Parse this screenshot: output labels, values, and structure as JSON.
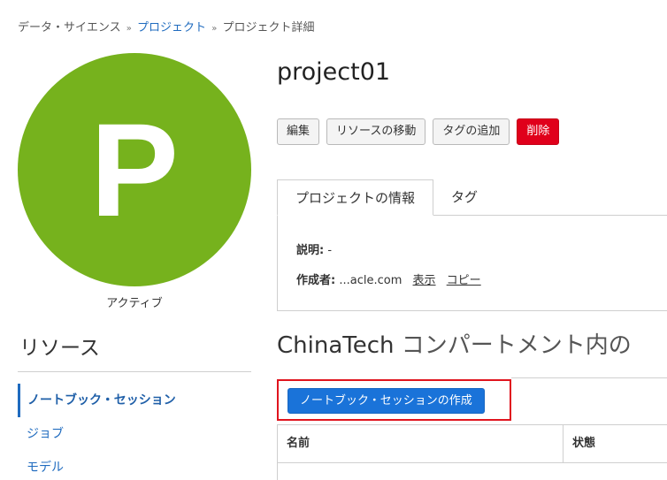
{
  "breadcrumb": {
    "root": "データ・サイエンス",
    "separator": "»",
    "projects": "プロジェクト",
    "current": "プロジェクト詳細"
  },
  "avatar": {
    "letter": "P",
    "color": "#76b21d"
  },
  "status": "アクティブ",
  "project": {
    "title": "project01"
  },
  "actions": {
    "edit": "編集",
    "move": "リソースの移動",
    "add_tag": "タグの追加",
    "delete": "削除"
  },
  "tabs": [
    {
      "label": "プロジェクトの情報",
      "active": true
    },
    {
      "label": "タグ",
      "active": false
    }
  ],
  "info": {
    "description_label": "説明:",
    "description_value": "-",
    "created_by_label": "作成者:",
    "created_by_value": "...acle.com",
    "show_link": "表示",
    "copy_link": "コピー"
  },
  "sidebar": {
    "heading": "リソース",
    "items": [
      {
        "label": "ノートブック・セッション",
        "active": true
      },
      {
        "label": "ジョブ",
        "active": false
      },
      {
        "label": "モデル",
        "active": false
      }
    ]
  },
  "section": {
    "heading_compartment": "ChinaTech",
    "heading_suffix": "コンパートメント内の"
  },
  "create_button": "ノートブック・セッションの作成",
  "table": {
    "columns": [
      "名前",
      "状態"
    ]
  },
  "colors": {
    "link": "#1f6bbf",
    "primary": "#1a73d9",
    "danger": "#e0001b",
    "highlight": "#e0141e"
  }
}
